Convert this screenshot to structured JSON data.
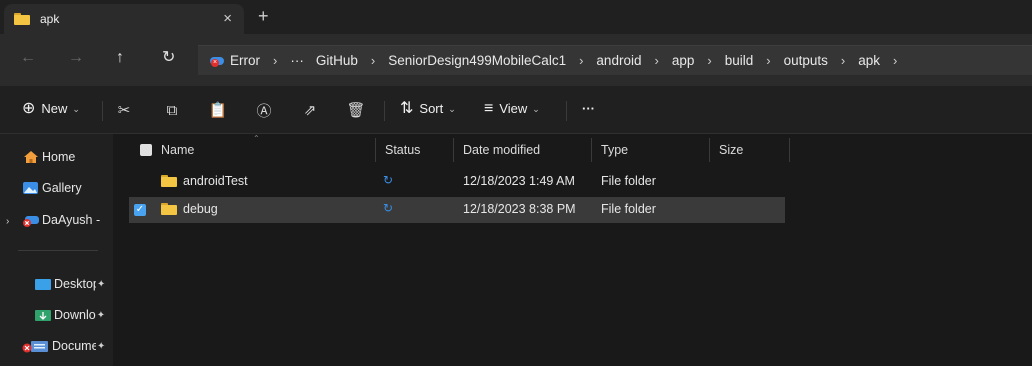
{
  "window": {
    "tab_title": "apk",
    "close_glyph": "×",
    "new_tab_glyph": "+"
  },
  "nav_buttons": {
    "back": "←",
    "forward": "→",
    "up": "↑",
    "refresh": "↻"
  },
  "breadcrumbs": [
    "Error",
    "···",
    "GitHub",
    "SeniorDesign499MobileCalc1",
    "android",
    "app",
    "build",
    "outputs",
    "apk"
  ],
  "breadcrumb_separator": "›",
  "toolbar": {
    "new_label": "New",
    "sort_label": "Sort",
    "view_label": "View",
    "more_label": "···",
    "dropdown_glyph": "⌄"
  },
  "sidebar": {
    "items": [
      {
        "label": "Home",
        "icon": "home-icon"
      },
      {
        "label": "Gallery",
        "icon": "gallery-icon"
      },
      {
        "label": "DaAyush -",
        "icon": "onedrive-error-icon"
      },
      {
        "label": "Desktop",
        "icon": "desktop-icon",
        "pinned": true
      },
      {
        "label": "Downlo",
        "icon": "downloads-icon",
        "pinned": true
      },
      {
        "label": "Docume",
        "icon": "documents-error-icon",
        "pinned": true
      }
    ],
    "pin_glyph": "📌"
  },
  "columns": {
    "name": "Name",
    "status": "Status",
    "date_modified": "Date modified",
    "type": "Type",
    "size": "Size"
  },
  "rows": [
    {
      "name": "androidTest",
      "date": "12/18/2023 1:49 AM",
      "type": "File folder",
      "selected": false
    },
    {
      "name": "debug",
      "date": "12/18/2023 8:38 PM",
      "type": "File folder",
      "selected": true
    }
  ],
  "colors": {
    "accent": "#4aa3f0",
    "folder": "#f4c542",
    "sync": "#3b8ee6",
    "error": "#e0302e"
  }
}
